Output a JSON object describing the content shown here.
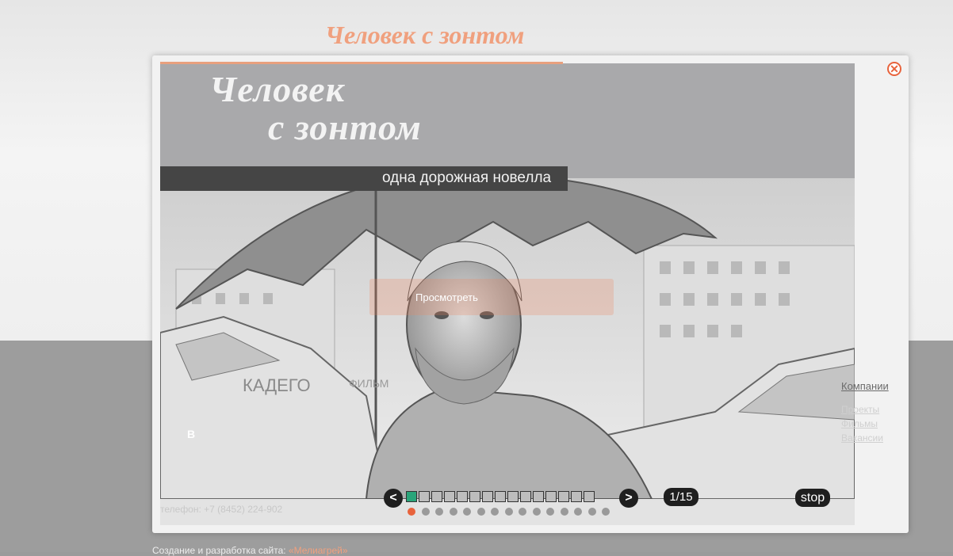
{
  "page": {
    "title": "Человек с зонтом",
    "subtitle": "одна дорожная новелла",
    "footer_credit_prefix": "Создание и разработка сайта:",
    "footer_credit_brand": "«Мелиагрей»",
    "phone": "телефон:  +7 (8452) 224-902",
    "company_link": "Компании",
    "link2": "Проекты",
    "link3": "Фильмы",
    "link4": "Вакансии",
    "ghost_button": "Просмотреть",
    "logo_text": "КАДЕГО",
    "logo_tag": "ФИЛЬМ"
  },
  "lightbox": {
    "slide_title_line1": "Человек",
    "slide_title_line2": "с зонтом",
    "slide_subtitle": "одна дорожная новелла",
    "prev_label": "<",
    "next_label": ">",
    "counter": "1/15",
    "stop_label": "stop",
    "close_icon": "close-icon",
    "total_slides": 15,
    "current_slide": 1,
    "progress": 0.58,
    "colors": {
      "accent": "#e8633c",
      "title_color": "#f0a07e",
      "active_thumb": "#2aa57a",
      "control_bg": "#1f1f1f"
    }
  }
}
